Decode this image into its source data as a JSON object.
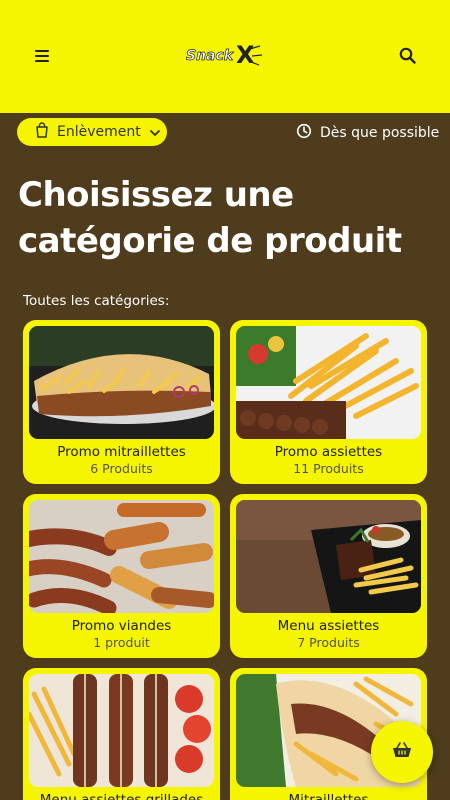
{
  "header": {
    "logo_text": "SnackX",
    "menu_icon": "hamburger-menu-icon",
    "search_icon": "search-icon"
  },
  "subbar": {
    "mode_label": "Enlèvement",
    "timing_label": "Dès que possible"
  },
  "main": {
    "title": "Choisissez une catégorie de produit",
    "section_label": "Toutes les catégories:",
    "categories": [
      {
        "name": "Promo mitraillettes",
        "count": "6 Produits"
      },
      {
        "name": "Promo assiettes",
        "count": "11 Produits"
      },
      {
        "name": "Promo viandes",
        "count": "1 produit"
      },
      {
        "name": "Menu assiettes",
        "count": "7 Produits"
      },
      {
        "name": "Menu assiettes grillades",
        "count": ""
      },
      {
        "name": "Mitraillettes",
        "count": ""
      }
    ]
  },
  "colors": {
    "accent": "#f6f500",
    "background": "#4e3c1d"
  }
}
